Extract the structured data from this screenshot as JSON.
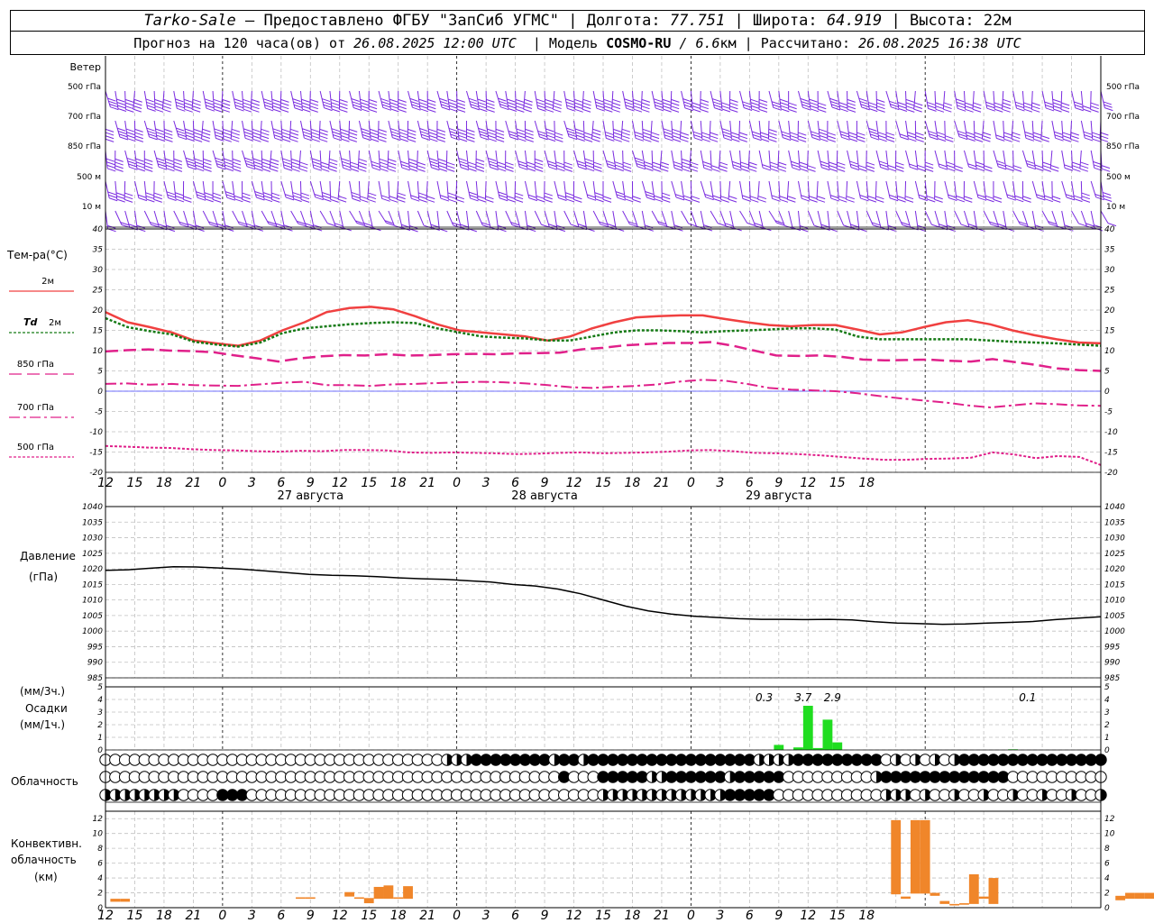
{
  "header": {
    "station": "Tarko-Sale",
    "provider": " – Предоставлено ФГБУ \"ЗапСиб УГМС\" | ",
    "lon_label": "Долгота: ",
    "lon": "77.751",
    "lat_label": " | Широта: ",
    "lat": "64.919",
    "alt_label": " | Высота: ",
    "alt": "22м",
    "forecast_label": "Прогноз на 120 часа(ов) от ",
    "forecast_time": "26.08.2025 12:00 UTC",
    "model_label": "  | Модель ",
    "model": "COSMO-RU",
    "resolution": " / 6.6",
    "resolution_unit": "км",
    "computed_label": " | Рассчитано: ",
    "computed_time": "26.08.2025 16:38 UTC"
  },
  "colors": {
    "wind": "#7a2be0",
    "t2m": "#f04040",
    "td2m": "#157a15",
    "t850": "#e0208a",
    "t700": "#e0208a",
    "t500": "#e0208a",
    "zero_line": "#4040ff",
    "precip": "#20dd20",
    "conv": "#f0862a",
    "pressure": "#000000"
  },
  "chart_data": [
    {
      "type": "wind-barbs",
      "panel_label": "Ветер",
      "levels": [
        "500 гПа",
        "700 гПа",
        "850 гПа",
        "500 м",
        "10 м"
      ],
      "note": "barbs every 1 hour from 26.08 12 UTC to 29.08 18 UTC"
    },
    {
      "type": "line",
      "ylabel": "Тем-ра(°C)",
      "ylim": [
        -20,
        40
      ],
      "yticks": [
        -20,
        -15,
        -10,
        -5,
        0,
        5,
        10,
        15,
        20,
        25,
        30,
        35,
        40
      ],
      "x_start": "2025-08-26 12:00 UTC",
      "x_step_hours": 3,
      "xticks": [
        "12",
        "15",
        "18",
        "21",
        "0",
        "3",
        "6",
        "9",
        "12",
        "15",
        "18",
        "21",
        "0",
        "3",
        "6",
        "9",
        "12",
        "15",
        "18",
        "21",
        "0",
        "3",
        "6",
        "9",
        "12",
        "15",
        "18"
      ],
      "day_labels": [
        "27 августа",
        "28 августа",
        "29 августа"
      ],
      "series": [
        {
          "name": "2м",
          "legend_prefix": "",
          "values": [
            19.5,
            17,
            15.8,
            14.5,
            12.5,
            11.8,
            11.2,
            12.5,
            15,
            17,
            19.5,
            20.5,
            20.8,
            20.2,
            18.5,
            16.5,
            15,
            14.5,
            14,
            13.5,
            12.5,
            13.5,
            15.5,
            17,
            18.2,
            18.5,
            18.7,
            18.7,
            17.8,
            17,
            16.3,
            16,
            16.3,
            16.3,
            15.2,
            14,
            14.5,
            15.8,
            17,
            17.5,
            16.5,
            15,
            13.8,
            12.8,
            12,
            11.8
          ]
        },
        {
          "name": "2м",
          "legend_prefix": "Td",
          "values": [
            18,
            15.8,
            14.8,
            14,
            12.2,
            11.5,
            11,
            12,
            14.3,
            15.5,
            16,
            16.5,
            16.8,
            17,
            16.8,
            15.5,
            14.5,
            13.5,
            13.2,
            13,
            12.5,
            12.5,
            13.5,
            14.5,
            15,
            15,
            14.8,
            14.5,
            14.8,
            15,
            15.2,
            15.5,
            15.5,
            15.2,
            13.5,
            12.8,
            12.8,
            12.8,
            12.8,
            12.8,
            12.5,
            12.2,
            12,
            11.8,
            11.5,
            11.2
          ]
        },
        {
          "name": "850 гПа",
          "legend_prefix": "",
          "values": [
            9.8,
            10.1,
            10.3,
            10,
            9.9,
            9.6,
            8.8,
            8.1,
            7.3,
            8.1,
            8.6,
            8.9,
            8.8,
            9.1,
            8.8,
            8.9,
            9.1,
            9.2,
            9.1,
            9.3,
            9.4,
            9.5,
            10.3,
            10.7,
            11.3,
            11.6,
            11.9,
            11.9,
            12.1,
            11.2,
            10,
            8.8,
            8.7,
            8.8,
            8.5,
            7.8,
            7.6,
            7.7,
            7.8,
            7.5,
            7.3,
            7.9,
            7.2,
            6.5,
            5.6,
            5.2,
            5
          ]
        },
        {
          "name": "700 гПа",
          "legend_prefix": "",
          "values": [
            1.8,
            1.9,
            1.6,
            1.8,
            1.5,
            1.4,
            1.3,
            1.7,
            2.1,
            2.3,
            1.5,
            1.5,
            1.3,
            1.7,
            1.8,
            2,
            2.2,
            2.3,
            2.2,
            1.9,
            1.5,
            1,
            0.8,
            1.1,
            1.3,
            1.7,
            2.4,
            2.8,
            2.6,
            1.8,
            0.8,
            0.4,
            0.2,
            0,
            -0.5,
            -1.2,
            -1.8,
            -2.3,
            -2.8,
            -3.5,
            -4,
            -3.5,
            -3,
            -3.2,
            -3.5,
            -3.6
          ]
        },
        {
          "name": "500 гПа",
          "legend_prefix": "",
          "values": [
            -13.5,
            -13.7,
            -13.9,
            -14,
            -14.3,
            -14.5,
            -14.6,
            -14.8,
            -14.9,
            -14.7,
            -14.8,
            -14.5,
            -14.5,
            -14.6,
            -15.1,
            -15.2,
            -15.1,
            -15.2,
            -15.3,
            -15.5,
            -15.4,
            -15.2,
            -15.1,
            -15.3,
            -15.2,
            -15.1,
            -14.9,
            -14.6,
            -14.5,
            -14.8,
            -15.2,
            -15.3,
            -15.5,
            -15.8,
            -16.2,
            -16.6,
            -16.9,
            -16.9,
            -16.7,
            -16.6,
            -16.4,
            -15.1,
            -15.6,
            -16.5,
            -16,
            -16.2,
            -18.2
          ]
        }
      ]
    },
    {
      "type": "line",
      "ylabel": "Давление",
      "ylabel2": "(гПа)",
      "ylim": [
        985,
        1040
      ],
      "yticks": [
        985,
        990,
        995,
        1000,
        1005,
        1010,
        1015,
        1020,
        1025,
        1030,
        1035,
        1040
      ],
      "series": [
        {
          "name": "Давление",
          "values": [
            1019.5,
            1019.7,
            1020.2,
            1020.7,
            1020.6,
            1020.3,
            1019.9,
            1019.4,
            1018.8,
            1018.2,
            1017.9,
            1017.8,
            1017.5,
            1017.1,
            1016.8,
            1016.6,
            1016.2,
            1015.8,
            1015,
            1014.5,
            1013.5,
            1012,
            1010,
            1008,
            1006.5,
            1005.5,
            1004.8,
            1004.4,
            1004,
            1003.8,
            1003.8,
            1003.7,
            1003.8,
            1003.6,
            1003,
            1002.6,
            1002.4,
            1002.2,
            1002.3,
            1002.6,
            1002.8,
            1003.1,
            1003.7,
            1004.2,
            1004.6
          ]
        }
      ]
    },
    {
      "type": "bar",
      "ylabel": "(мм/3ч.)",
      "ylabel2": "Осадки",
      "ylabel3": "(мм/1ч.)",
      "ylim": [
        0,
        5
      ],
      "yticks": [
        0,
        1,
        2,
        3,
        4,
        5
      ],
      "bars_hourly": [
        {
          "hour": 69,
          "value": 0.4
        },
        {
          "hour": 71,
          "value": 0.2
        },
        {
          "hour": 72,
          "value": 3.5
        },
        {
          "hour": 73,
          "value": 0.15
        },
        {
          "hour": 74,
          "value": 2.4
        },
        {
          "hour": 75,
          "value": 0.6
        },
        {
          "hour": 93,
          "value": 0.05
        }
      ],
      "totals_3h": [
        {
          "hour": 67.5,
          "label": "0.3"
        },
        {
          "hour": 71.5,
          "label": "3.7"
        },
        {
          "hour": 74.5,
          "label": "2.9"
        },
        {
          "hour": 94.5,
          "label": "0.1"
        }
      ]
    },
    {
      "type": "cloud-symbols",
      "ylabel": "Облачность",
      "rows": [
        "0000000000000000000000000000000000000000000000000000000000444444444444444444444444444444444444444444444444",
        "000000000000000000000000000000000000000000000000000000000000000000000000000000000000000000000000000000000000000000000000000444444444444444444444444444000000000000000000000004444444444",
        "0000000000000000000000000000000000000000000000000000000000000000000000000000000000000000444444444444000000000000000000000000000000000000000"
      ],
      "note": "octa 0 = empty circle, 4 = half filled, 8 = filled"
    },
    {
      "type": "range-bar",
      "ylabel": "Конвективн.",
      "ylabel2": "облачность",
      "ylabel3": "(км)",
      "ylim": [
        0,
        13
      ],
      "yticks": [
        0,
        2,
        4,
        6,
        8,
        10,
        12
      ],
      "bars": [
        {
          "hour": 1,
          "bottom": 0.8,
          "top": 1.2
        },
        {
          "hour": 2,
          "bottom": 0.8,
          "top": 1.2
        },
        {
          "hour": 20,
          "bottom": 1.2,
          "top": 1.4
        },
        {
          "hour": 21,
          "bottom": 1.2,
          "top": 1.4
        },
        {
          "hour": 25,
          "bottom": 1.5,
          "top": 2.1
        },
        {
          "hour": 26,
          "bottom": 1.2,
          "top": 1.4
        },
        {
          "hour": 27,
          "bottom": 0.6,
          "top": 1.3
        },
        {
          "hour": 28,
          "bottom": 1.2,
          "top": 2.8
        },
        {
          "hour": 29,
          "bottom": 1.2,
          "top": 3.0
        },
        {
          "hour": 30,
          "bottom": 1.2,
          "top": 1.4
        },
        {
          "hour": 31,
          "bottom": 1.2,
          "top": 2.9
        },
        {
          "hour": 81,
          "bottom": 1.8,
          "top": 11.8
        },
        {
          "hour": 82,
          "bottom": 1.2,
          "top": 1.5
        },
        {
          "hour": 83,
          "bottom": 1.9,
          "top": 11.8
        },
        {
          "hour": 84,
          "bottom": 1.9,
          "top": 11.8
        },
        {
          "hour": 85,
          "bottom": 1.6,
          "top": 2.0
        },
        {
          "hour": 86,
          "bottom": 0.5,
          "top": 0.9
        },
        {
          "hour": 87,
          "bottom": 0.3,
          "top": 0.5
        },
        {
          "hour": 88,
          "bottom": 0.4,
          "top": 0.6
        },
        {
          "hour": 89,
          "bottom": 0.5,
          "top": 4.5
        },
        {
          "hour": 90,
          "bottom": 1.2,
          "top": 1.5
        },
        {
          "hour": 91,
          "bottom": 0.5,
          "top": 4.0
        },
        {
          "hour": 104,
          "bottom": 1.0,
          "top": 1.6
        },
        {
          "hour": 105,
          "bottom": 1.2,
          "top": 2.0
        },
        {
          "hour": 106,
          "bottom": 1.2,
          "top": 2.0
        },
        {
          "hour": 107,
          "bottom": 1.2,
          "top": 2.0
        },
        {
          "hour": 108,
          "bottom": 1.3,
          "top": 2.2
        },
        {
          "hour": 109,
          "bottom": 3.8,
          "top": 4.5
        },
        {
          "hour": 110,
          "bottom": 4.2,
          "top": 5.0
        },
        {
          "hour": 111,
          "bottom": 4.4,
          "top": 5.4
        },
        {
          "hour": 112,
          "bottom": 1.3,
          "top": 2.4
        },
        {
          "hour": 113,
          "bottom": 4.0,
          "top": 4.8
        }
      ]
    }
  ]
}
